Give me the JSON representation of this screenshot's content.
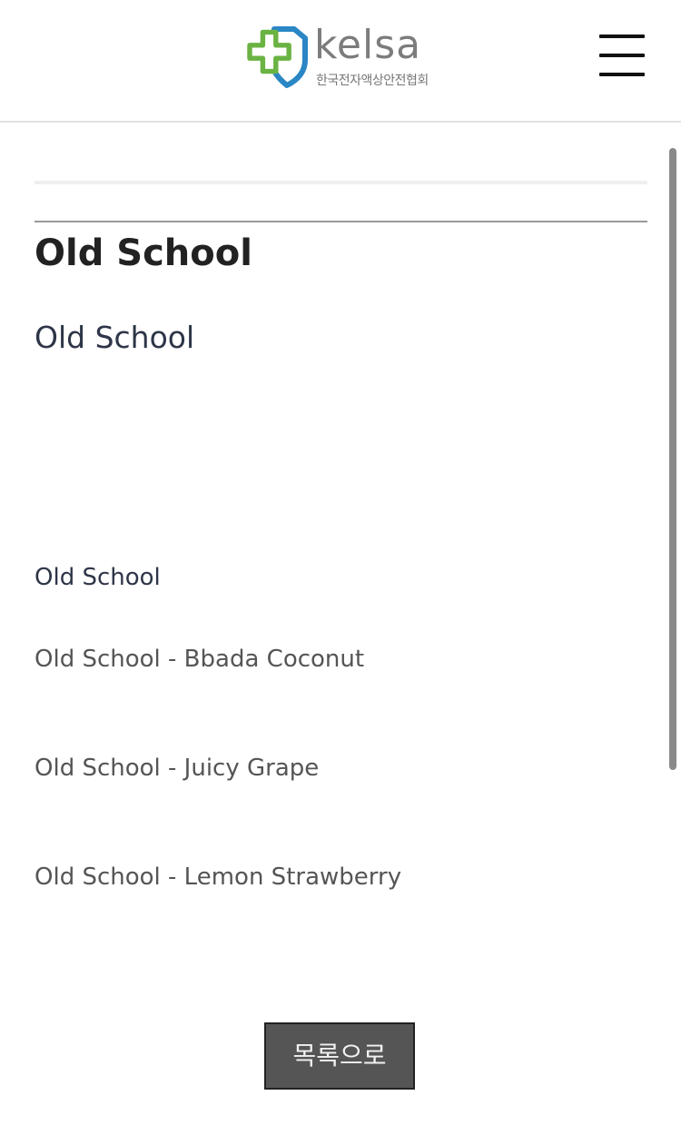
{
  "header": {
    "logo_text": "kelsa",
    "logo_subtitle": "한국전자액상안전협회",
    "logo_colors": {
      "green": "#6ab343",
      "blue": "#2b86c5"
    }
  },
  "post": {
    "title": "Old School",
    "subtitle": "Old School",
    "label": "Old School",
    "items": [
      "Old School - Bbada Coconut",
      "Old School - Juicy Grape",
      "Old School - Lemon Strawberry"
    ]
  },
  "list_button": "목록으로"
}
